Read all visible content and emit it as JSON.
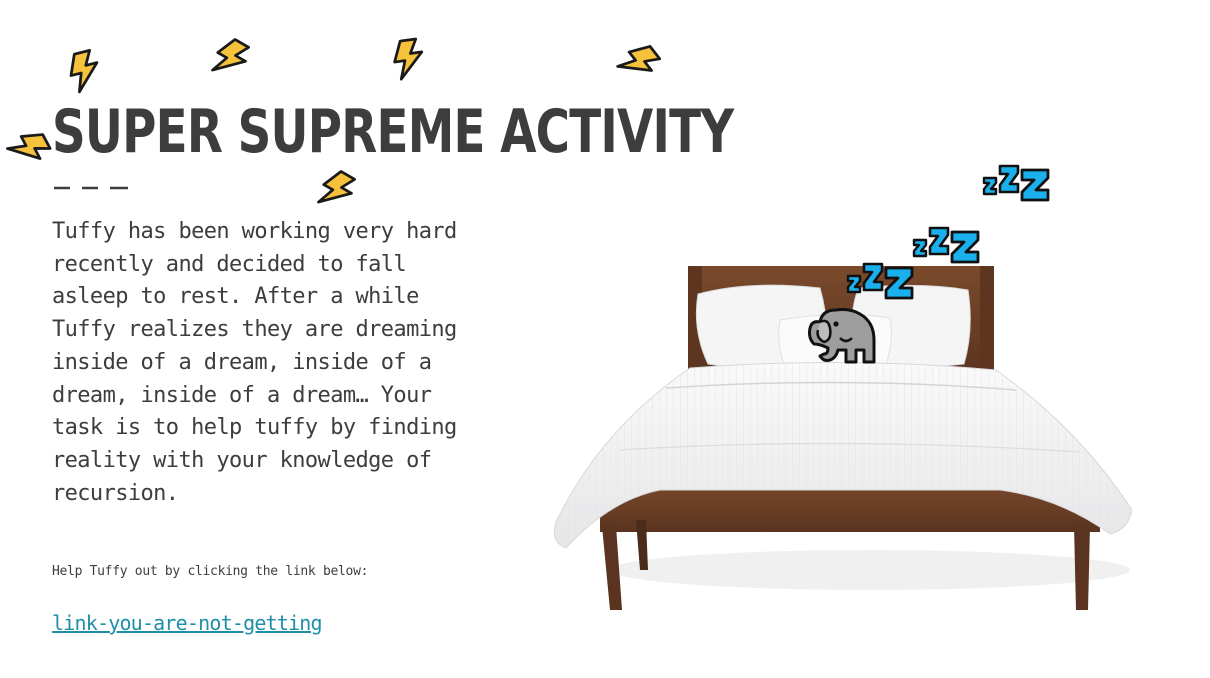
{
  "heading": {
    "title": "SUPER SUPREME ACTIVITY"
  },
  "story": {
    "paragraph": "Tuffy has been working very hard recently and decided to fall asleep to rest. After a while Tuffy realizes they are dreaming inside of a dream, inside of a dream, inside of a dream… Your task is to help tuffy by finding reality with your knowledge of recursion."
  },
  "cta": {
    "help_text": "Help Tuffy out by clicking the link below:",
    "link_text": "link-you-are-not-getting"
  },
  "illustration": {
    "icons": [
      "lightning-bolt-icon",
      "bed",
      "elephant-icon",
      "sleeping-zzz-icon"
    ]
  },
  "colors": {
    "title": "#3d3d3d",
    "body_text": "#3d3d3d",
    "link": "#1f8fa8",
    "bolt_fill": "#f7c23b",
    "zzz_fill": "#1ab0ee",
    "wood": "#6b3f24"
  }
}
